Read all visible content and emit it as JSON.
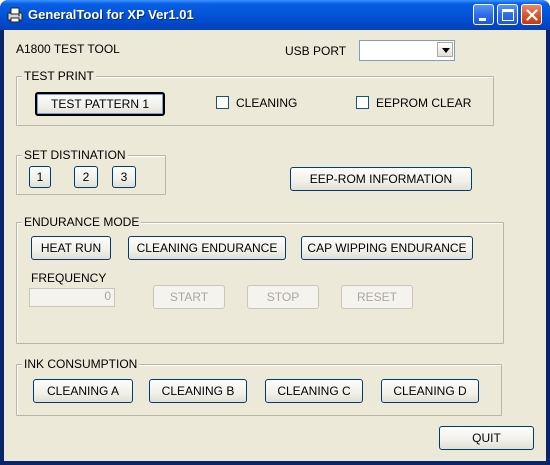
{
  "window": {
    "title": "GeneralTool for XP Ver1.01",
    "icon": "printer-icon"
  },
  "header": {
    "tool_name": "A1800 TEST TOOL",
    "usb_port_label": "USB PORT",
    "usb_port_value": ""
  },
  "test_print": {
    "title": "TEST PRINT",
    "test_pattern_label": "TEST PATTERN 1",
    "cleaning_label": "CLEANING",
    "cleaning_checked": false,
    "eeprom_clear_label": "EEPROM CLEAR",
    "eeprom_clear_checked": false
  },
  "set_destination": {
    "title": "SET DISTINATION",
    "buttons": [
      "1",
      "2",
      "3"
    ]
  },
  "eeprom_info_label": "EEP-ROM INFORMATION",
  "endurance": {
    "title": "ENDURANCE MODE",
    "heat_run_label": "HEAT RUN",
    "cleaning_endurance_label": "CLEANING ENDURANCE",
    "cap_wiping_label": "CAP WIPPING ENDURANCE",
    "frequency_label": "FREQUENCY",
    "frequency_value": "0",
    "start_label": "START",
    "stop_label": "STOP",
    "reset_label": "RESET"
  },
  "ink": {
    "title": "INK CONSUMPTION",
    "buttons": [
      "CLEANING A",
      "CLEANING B",
      "CLEANING C",
      "CLEANING D"
    ]
  },
  "quit_label": "QUIT",
  "colors": {
    "title_bar": "#0354d8",
    "face": "#ece9d8",
    "button_border": "#003c74",
    "close_button": "#d9542c"
  }
}
